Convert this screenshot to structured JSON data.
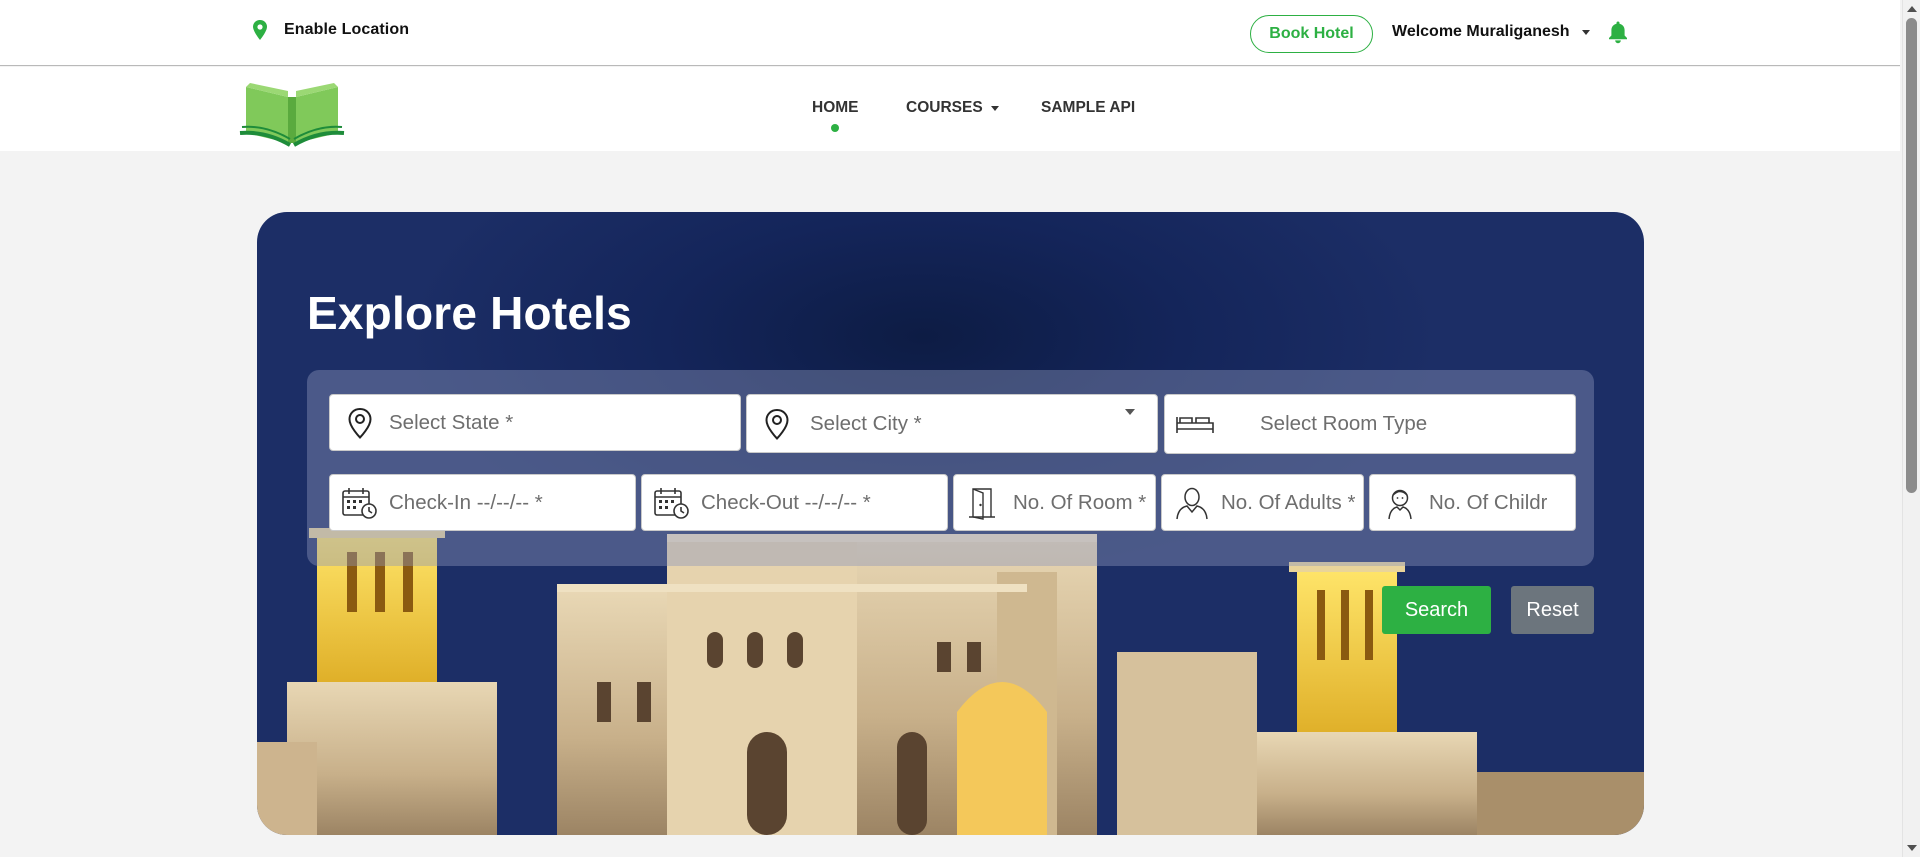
{
  "topbar": {
    "location_label": "Enable Location",
    "book_hotel_label": "Book Hotel",
    "welcome_label": "Welcome Muraliganesh"
  },
  "nav": {
    "items": [
      {
        "label": "HOME",
        "active": true
      },
      {
        "label": "COURSES",
        "has_dropdown": true
      },
      {
        "label": "SAMPLE API"
      }
    ]
  },
  "hero": {
    "title": "Explore Hotels",
    "fields": {
      "state_placeholder": "Select State *",
      "city_placeholder": "Select City *",
      "room_type_placeholder": "Select Room Type",
      "checkin_placeholder": "Check-In --/--/-- *",
      "checkout_placeholder": "Check-Out --/--/-- *",
      "rooms_placeholder": "No. Of Room *",
      "adults_placeholder": "No. Of Adults *",
      "children_placeholder": "No. Of Childr"
    },
    "search_label": "Search",
    "reset_label": "Reset"
  },
  "colors": {
    "accent": "#2db043",
    "hero_bg": "#14255a",
    "reset_button": "#6c757d"
  },
  "icons": [
    "location-pin-icon",
    "bell-icon",
    "book-logo",
    "map-pin-icon",
    "bed-icon",
    "calendar-clock-icon",
    "door-icon",
    "adult-person-icon",
    "child-person-icon",
    "dropdown-caret-icon"
  ]
}
